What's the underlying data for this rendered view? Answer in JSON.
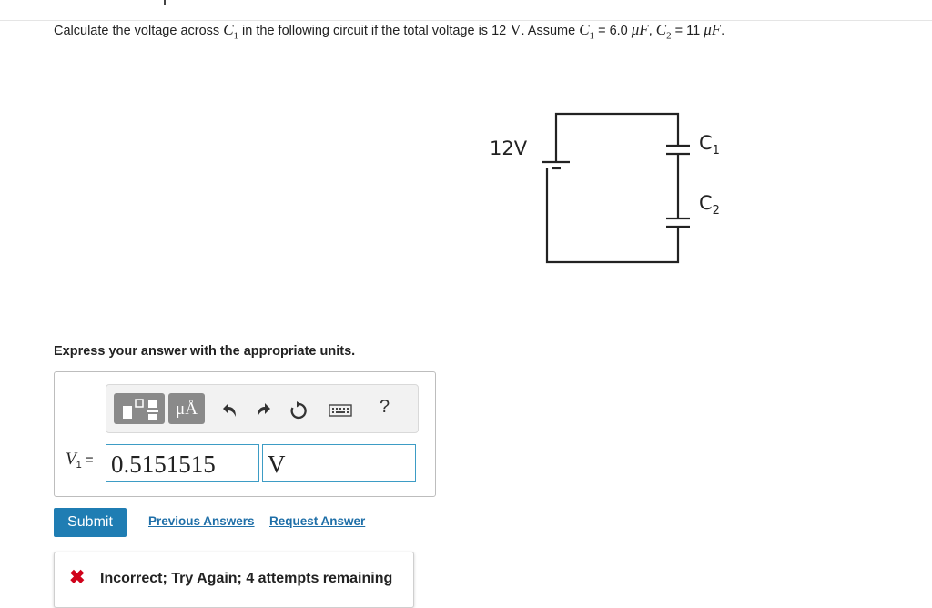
{
  "question": {
    "part1": "Calculate the voltage across ",
    "c1_symbol": "C",
    "c1_sub": "1",
    "part2": " in the following circuit if the total voltage is 12 ",
    "unit_V": "V",
    "part3": ". Assume ",
    "c1_value": " = 6.0 ",
    "unit_uF": "μF",
    "comma": ", ",
    "c2_symbol": "C",
    "c2_sub": "2",
    "c2_value": " = 11 ",
    "unit_uF2": "μF",
    "period": "."
  },
  "circuit": {
    "battery_label": "12V",
    "c1_label": "C",
    "c1_sub": "1",
    "c2_label": "C",
    "c2_sub": "2"
  },
  "instructions": "Express your answer with the appropriate units.",
  "toolbar": {
    "units_label": "μÅ",
    "icons": [
      "templates-icon",
      "units-icon",
      "undo-icon",
      "redo-icon",
      "reset-icon",
      "keyboard-icon",
      "help-icon"
    ],
    "help_label": "?"
  },
  "answer": {
    "var_symbol": "V",
    "var_sub": "1",
    "equals": " = ",
    "value": "0.5151515",
    "unit": "V"
  },
  "actions": {
    "submit_label": "Submit",
    "previous_label": "Previous Answers",
    "request_label": "Request Answer"
  },
  "feedback": {
    "icon": "x-icon",
    "message": "Incorrect; Try Again; 4 attempts remaining"
  },
  "colors": {
    "accent": "#1f7db3",
    "link": "#1f6fa8",
    "error": "#d0021b",
    "field_border": "#3d9cc5"
  }
}
